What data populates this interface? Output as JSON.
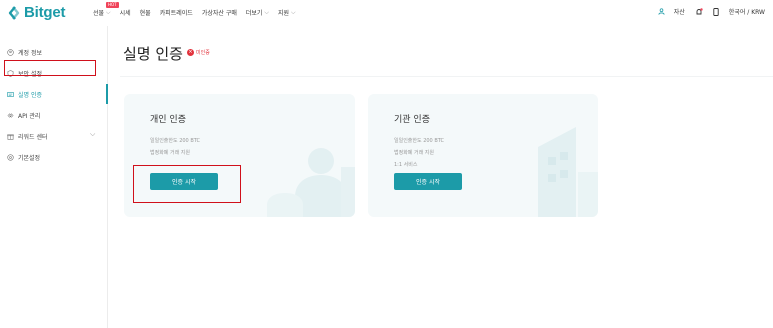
{
  "brand": {
    "name": "Bitget",
    "color": "#1c9ba8"
  },
  "nav": {
    "items": [
      {
        "label": "선물",
        "has_chevron": true,
        "badge": "HOT"
      },
      {
        "label": "시세",
        "has_chevron": false
      },
      {
        "label": "현물",
        "has_chevron": false
      },
      {
        "label": "카피트레이드",
        "has_chevron": false
      },
      {
        "label": "가상자산 구매",
        "has_chevron": false
      },
      {
        "label": "더보기",
        "has_chevron": true
      },
      {
        "label": "지원",
        "has_chevron": true
      }
    ],
    "assets_label": "자산",
    "language_label": "한국어 / KRW"
  },
  "sidebar": {
    "items": [
      {
        "label": "계정 정보",
        "icon": "person-icon"
      },
      {
        "label": "보안 설정",
        "icon": "shield-icon"
      },
      {
        "label": "실명 인증",
        "icon": "id-card-icon",
        "active": true
      },
      {
        "label": "API 관리",
        "icon": "api-icon"
      },
      {
        "label": "리워드 센터",
        "icon": "gift-icon",
        "has_chevron": true
      },
      {
        "label": "기본설정",
        "icon": "settings-icon"
      }
    ]
  },
  "main": {
    "title": "실명 인증",
    "status": "미인증",
    "cards": [
      {
        "title": "개인 인증",
        "lines": [
          "일일인출한도 200 BTC",
          "법정화폐 거래 지원"
        ],
        "button": "인증 시작"
      },
      {
        "title": "기관 인증",
        "lines": [
          "일일인출한도 200 BTC",
          "법정화폐 거래 지원",
          "1:1 서비스"
        ],
        "button": "인증 시작"
      }
    ]
  },
  "colors": {
    "accent": "#1c9ba8",
    "highlight": "#d0101b",
    "error": "#e2323c"
  }
}
